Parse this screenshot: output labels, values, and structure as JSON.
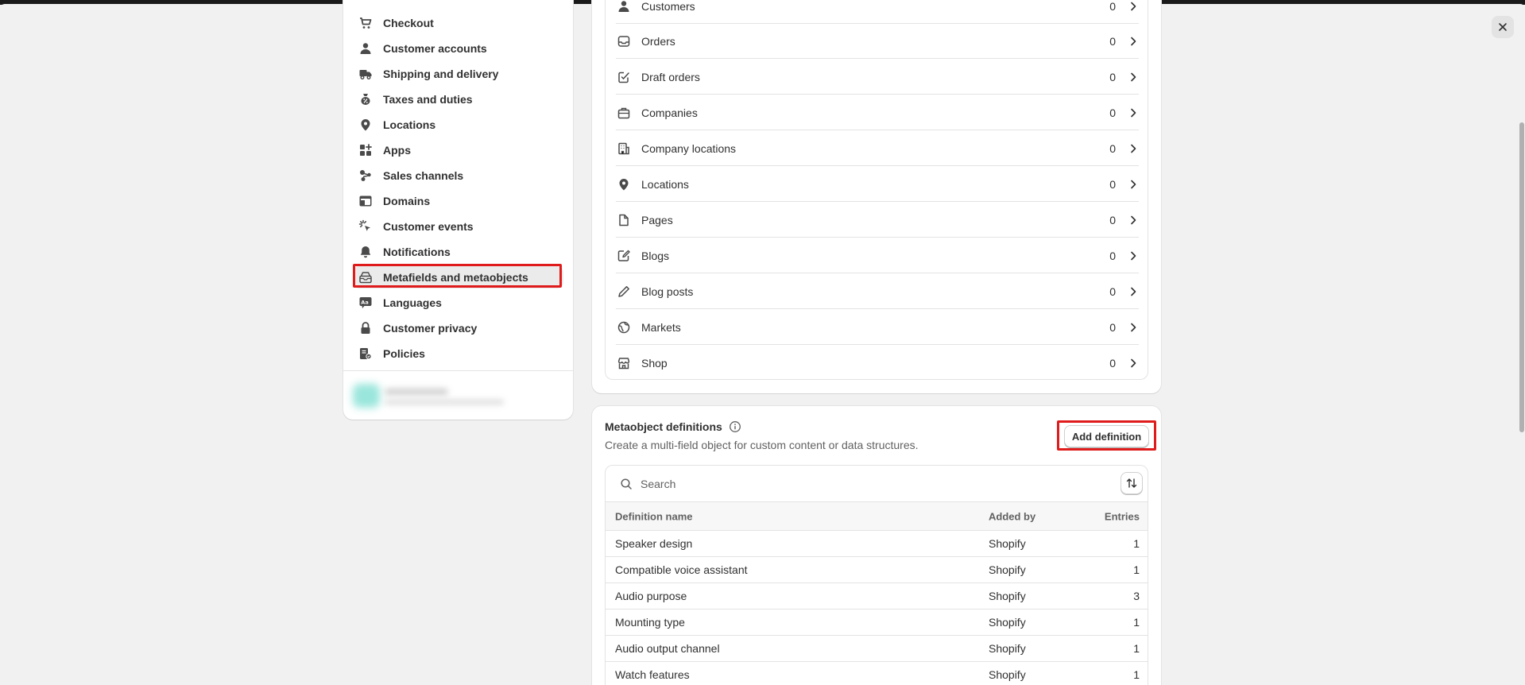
{
  "sidebar": {
    "items": [
      {
        "label": "Checkout",
        "icon": "cart-icon"
      },
      {
        "label": "Customer accounts",
        "icon": "person-icon"
      },
      {
        "label": "Shipping and delivery",
        "icon": "truck-icon"
      },
      {
        "label": "Taxes and duties",
        "icon": "tax-icon"
      },
      {
        "label": "Locations",
        "icon": "location-pin-icon"
      },
      {
        "label": "Apps",
        "icon": "apps-icon"
      },
      {
        "label": "Sales channels",
        "icon": "sales-channels-icon"
      },
      {
        "label": "Domains",
        "icon": "globe-window-icon"
      },
      {
        "label": "Customer events",
        "icon": "cursor-click-icon"
      },
      {
        "label": "Notifications",
        "icon": "bell-icon"
      },
      {
        "label": "Metafields and metaobjects",
        "icon": "metafields-icon"
      },
      {
        "label": "Languages",
        "icon": "language-icon"
      },
      {
        "label": "Customer privacy",
        "icon": "lock-icon"
      },
      {
        "label": "Policies",
        "icon": "policy-icon"
      }
    ],
    "active_index": 10
  },
  "metafields": {
    "rows": [
      {
        "label": "Customers",
        "count": "0",
        "icon": "person-icon"
      },
      {
        "label": "Orders",
        "count": "0",
        "icon": "inbox-icon"
      },
      {
        "label": "Draft orders",
        "count": "0",
        "icon": "draft-order-icon"
      },
      {
        "label": "Companies",
        "count": "0",
        "icon": "company-icon"
      },
      {
        "label": "Company locations",
        "count": "0",
        "icon": "building-icon"
      },
      {
        "label": "Locations",
        "count": "0",
        "icon": "location-pin-icon"
      },
      {
        "label": "Pages",
        "count": "0",
        "icon": "page-icon"
      },
      {
        "label": "Blogs",
        "count": "0",
        "icon": "blog-icon"
      },
      {
        "label": "Blog posts",
        "count": "0",
        "icon": "pencil-icon"
      },
      {
        "label": "Markets",
        "count": "0",
        "icon": "markets-globe-icon"
      },
      {
        "label": "Shop",
        "count": "0",
        "icon": "store-icon"
      }
    ]
  },
  "metaobjects": {
    "title": "Metaobject definitions",
    "description": "Create a multi-field object for custom content or data structures.",
    "add_button": "Add definition",
    "search_placeholder": "Search",
    "columns": {
      "name": "Definition name",
      "added_by": "Added by",
      "entries": "Entries"
    },
    "rows": [
      {
        "name": "Speaker design",
        "added_by": "Shopify",
        "entries": "1"
      },
      {
        "name": "Compatible voice assistant",
        "added_by": "Shopify",
        "entries": "1"
      },
      {
        "name": "Audio purpose",
        "added_by": "Shopify",
        "entries": "3"
      },
      {
        "name": "Mounting type",
        "added_by": "Shopify",
        "entries": "1"
      },
      {
        "name": "Audio output channel",
        "added_by": "Shopify",
        "entries": "1"
      },
      {
        "name": "Watch features",
        "added_by": "Shopify",
        "entries": "1"
      }
    ]
  },
  "colors": {
    "highlight": "#e01b1b",
    "text": "#303030",
    "muted": "#616161"
  }
}
